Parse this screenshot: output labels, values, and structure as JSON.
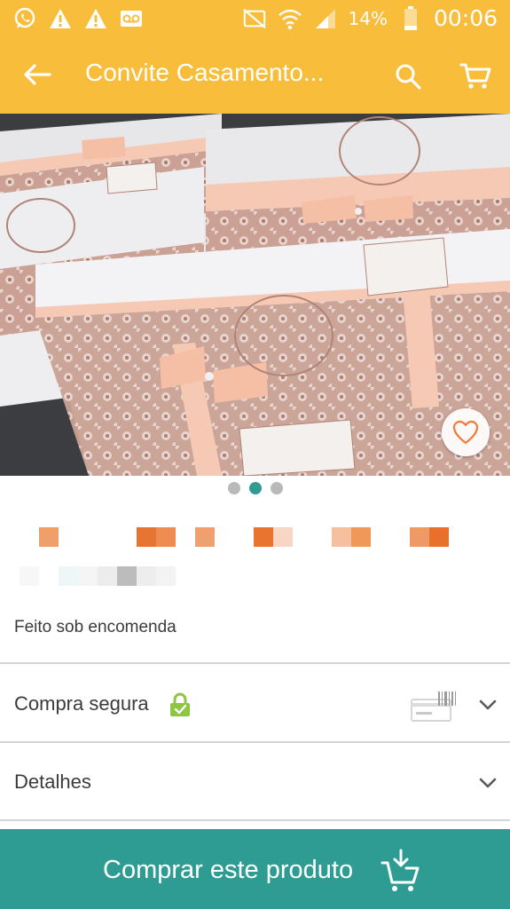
{
  "status_bar": {
    "icons": [
      "whatsapp-icon",
      "warning-icon",
      "warning-icon",
      "voicemail-icon"
    ],
    "battery_percent": "14%",
    "time": "00:06"
  },
  "app_bar": {
    "title": "Convite Casamento...",
    "icons": [
      "back-arrow-icon",
      "search-icon",
      "cart-icon"
    ]
  },
  "gallery": {
    "image_count": 3,
    "active_index": 1,
    "favorite_icon": "heart-icon"
  },
  "product": {
    "info": "Feito sob encomenda"
  },
  "sections": {
    "secure_purchase": {
      "label": "Compra segura",
      "icons": [
        "lock-icon",
        "credit-card-icon",
        "chevron-down-icon"
      ]
    },
    "details": {
      "label": "Detalhes",
      "icons": [
        "chevron-down-icon"
      ]
    }
  },
  "buy_button": {
    "label": "Comprar este produto",
    "icon": "cart-download-icon"
  },
  "colors": {
    "accent": "#f9bd3c",
    "primary": "#2f9c94",
    "text": "#3b3b3b",
    "divider": "#d4d4d4"
  }
}
